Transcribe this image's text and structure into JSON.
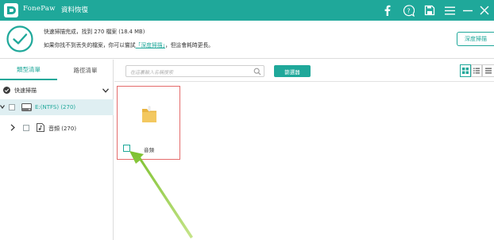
{
  "titlebar": {
    "brand": "FonePaw",
    "app_name": "資料恢復",
    "icons": [
      "facebook-icon",
      "help-icon",
      "save-icon",
      "menu-icon",
      "minimize-icon",
      "close-icon"
    ]
  },
  "status": {
    "line1": "快速掃描完成，找到 270 檔案 (18.4 MB)",
    "line2_prefix": "如果你找不到丟失的檔案，你可以嘗試",
    "line2_link": "「深度掃描」",
    "line2_suffix": "，但這會耗時更長。",
    "deep_scan_button": "深度掃描"
  },
  "sidebar": {
    "tabs": [
      {
        "label": "類型清單",
        "active": true
      },
      {
        "label": "路徑清單",
        "active": false
      }
    ],
    "quick_scan_label": "快速掃描",
    "drive_label": "E:(NTFS) (270)",
    "audio_label": "音頻 (270)"
  },
  "main": {
    "search_placeholder": "在這裏輸入名稱搜索",
    "filter_button": "篩選器",
    "views": [
      "grid-view-icon",
      "list-view-icon",
      "detail-view-icon"
    ],
    "card_label": "音頻"
  },
  "colors": {
    "accent": "#1fa89a",
    "selection_border": "#e46b6b",
    "annotation_arrow": "#8cc63f",
    "folder": "#f3c860"
  }
}
